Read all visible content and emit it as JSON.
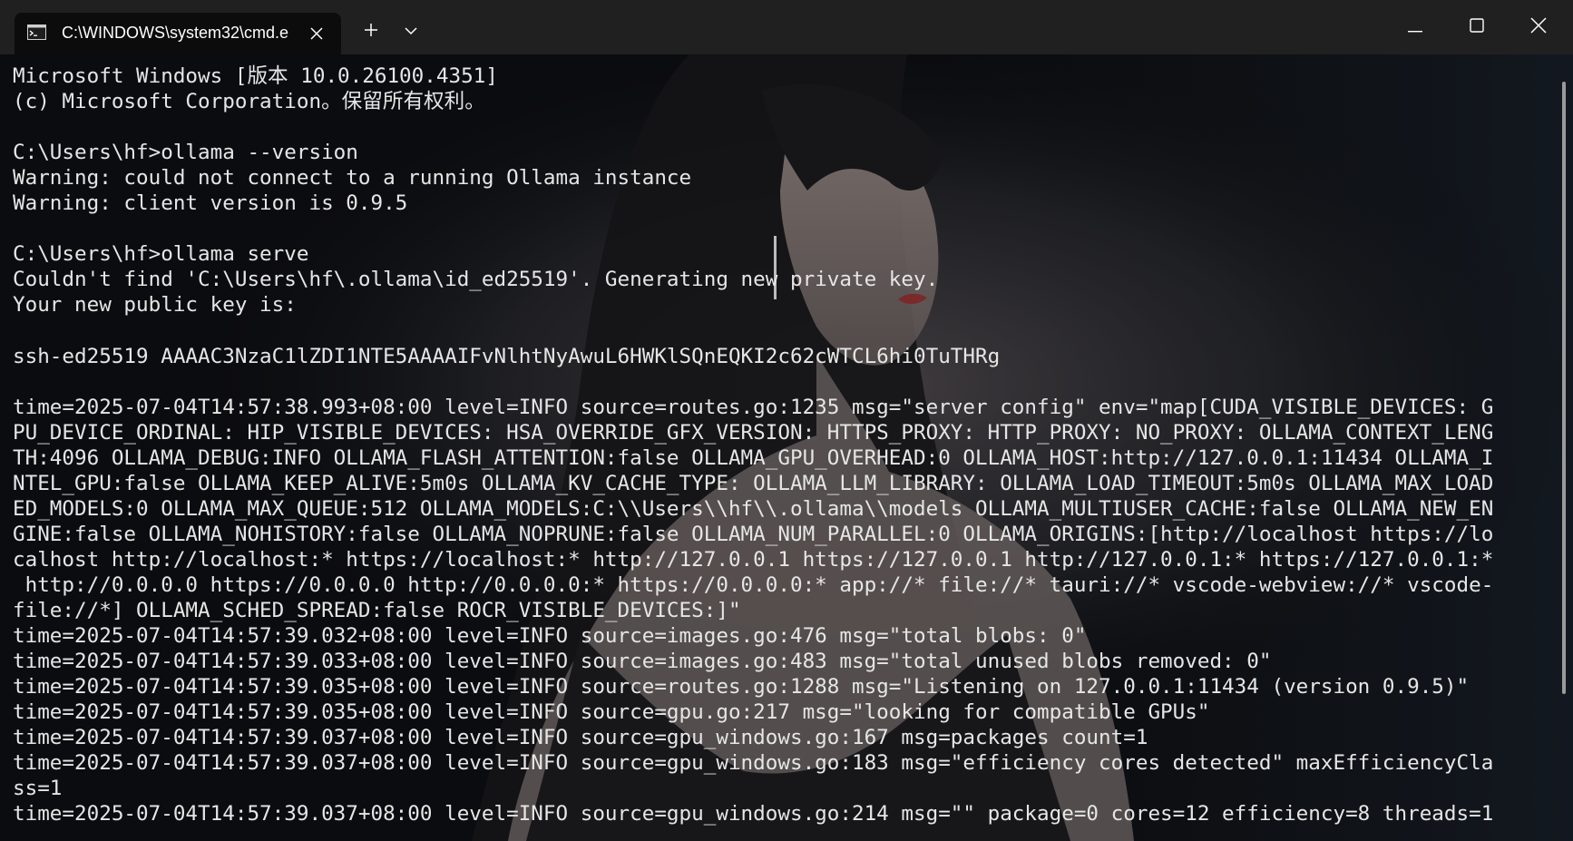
{
  "window": {
    "tab_title": "C:\\WINDOWS\\system32\\cmd.e",
    "tab_icon": "cmd-icon",
    "controls": {
      "new_tab": "+",
      "dropdown": "chevron-down-icon",
      "minimize": "minimize-icon",
      "maximize": "maximize-icon",
      "close": "close-icon"
    }
  },
  "terminal": {
    "lines": [
      "Microsoft Windows [版本 10.0.26100.4351]",
      "(c) Microsoft Corporation。保留所有权利。",
      "",
      "C:\\Users\\hf>ollama --version",
      "Warning: could not connect to a running Ollama instance",
      "Warning: client version is 0.9.5",
      "",
      "C:\\Users\\hf>ollama serve",
      "Couldn't find 'C:\\Users\\hf\\.ollama\\id_ed25519'. Generating new private key.",
      "Your new public key is:",
      "",
      "ssh-ed25519 AAAAC3NzaC1lZDI1NTE5AAAAIFvNlhtNyAwuL6HWKlSQnEQKI2c62cWTCL6hi0TuTHRg",
      "",
      "time=2025-07-04T14:57:38.993+08:00 level=INFO source=routes.go:1235 msg=\"server config\" env=\"map[CUDA_VISIBLE_DEVICES: G",
      "PU_DEVICE_ORDINAL: HIP_VISIBLE_DEVICES: HSA_OVERRIDE_GFX_VERSION: HTTPS_PROXY: HTTP_PROXY: NO_PROXY: OLLAMA_CONTEXT_LENG",
      "TH:4096 OLLAMA_DEBUG:INFO OLLAMA_FLASH_ATTENTION:false OLLAMA_GPU_OVERHEAD:0 OLLAMA_HOST:http://127.0.0.1:11434 OLLAMA_I",
      "NTEL_GPU:false OLLAMA_KEEP_ALIVE:5m0s OLLAMA_KV_CACHE_TYPE: OLLAMA_LLM_LIBRARY: OLLAMA_LOAD_TIMEOUT:5m0s OLLAMA_MAX_LOAD",
      "ED_MODELS:0 OLLAMA_MAX_QUEUE:512 OLLAMA_MODELS:C:\\\\Users\\\\hf\\\\.ollama\\\\models OLLAMA_MULTIUSER_CACHE:false OLLAMA_NEW_EN",
      "GINE:false OLLAMA_NOHISTORY:false OLLAMA_NOPRUNE:false OLLAMA_NUM_PARALLEL:0 OLLAMA_ORIGINS:[http://localhost https://lo",
      "calhost http://localhost:* https://localhost:* http://127.0.0.1 https://127.0.0.1 http://127.0.0.1:* https://127.0.0.1:*",
      " http://0.0.0.0 https://0.0.0.0 http://0.0.0.0:* https://0.0.0.0:* app://* file://* tauri://* vscode-webview://* vscode-",
      "file://*] OLLAMA_SCHED_SPREAD:false ROCR_VISIBLE_DEVICES:]\"",
      "time=2025-07-04T14:57:39.032+08:00 level=INFO source=images.go:476 msg=\"total blobs: 0\"",
      "time=2025-07-04T14:57:39.033+08:00 level=INFO source=images.go:483 msg=\"total unused blobs removed: 0\"",
      "time=2025-07-04T14:57:39.035+08:00 level=INFO source=routes.go:1288 msg=\"Listening on 127.0.0.1:11434 (version 0.9.5)\"",
      "time=2025-07-04T14:57:39.035+08:00 level=INFO source=gpu.go:217 msg=\"looking for compatible GPUs\"",
      "time=2025-07-04T14:57:39.037+08:00 level=INFO source=gpu_windows.go:167 msg=packages count=1",
      "time=2025-07-04T14:57:39.037+08:00 level=INFO source=gpu_windows.go:183 msg=\"efficiency cores detected\" maxEfficiencyCla",
      "ss=1",
      "time=2025-07-04T14:57:39.037+08:00 level=INFO source=gpu_windows.go:214 msg=\"\" package=0 cores=12 efficiency=8 threads=1"
    ]
  },
  "colors": {
    "titlebar_bg": "#202020",
    "tab_bg": "#0c0c0c",
    "text": "#e6e6e6",
    "background": "#0a0b0d"
  }
}
